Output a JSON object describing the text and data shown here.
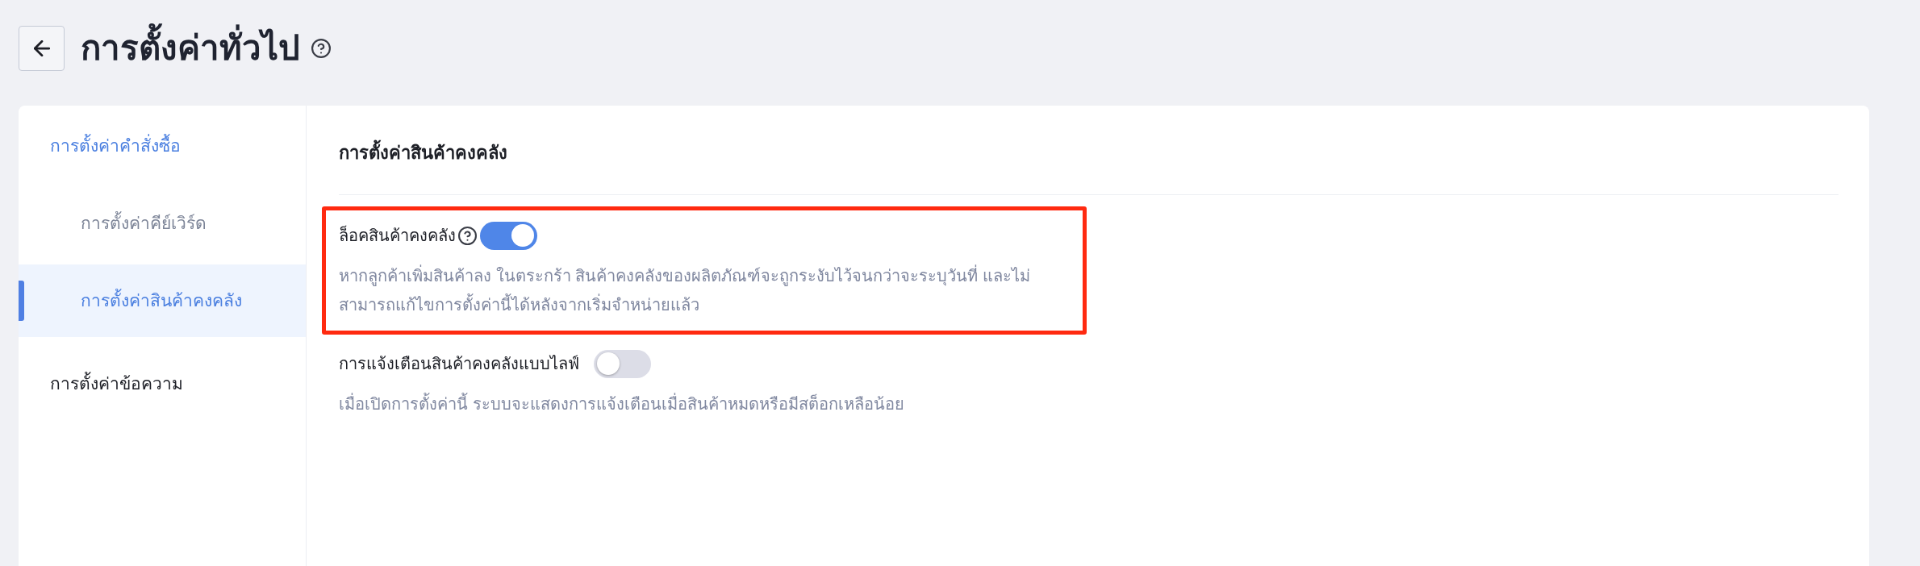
{
  "header": {
    "title": "การตั้งค่าทั่วไป"
  },
  "sidebar": {
    "items": [
      {
        "label": "การตั้งค่าคำสั่งซื้อ",
        "selected": false,
        "children": [
          {
            "label": "การตั้งค่าคีย์เวิร์ด",
            "selected": false
          },
          {
            "label": "การตั้งค่าสินค้าคงคลัง",
            "selected": true
          }
        ]
      },
      {
        "label": "การตั้งค่าข้อความ",
        "selected": false
      }
    ]
  },
  "section": {
    "title": "การตั้งค่าสินค้าคงคลัง",
    "settings": [
      {
        "label": "ล็อคสินค้าคงคลัง",
        "help_icon": true,
        "on": true,
        "highlighted": true,
        "description": "หากลูกค้าเพิ่มสินค้าลง ในตระกร้า สินค้าคงคลังของผลิตภัณฑ์จะถูกระงับไว้จนกว่าจะระบุวันที่ และไม่สามารถแก้ไขการตั้งค่านี้ได้หลังจากเริ่มจำหน่ายแล้ว"
      },
      {
        "label": "การแจ้งเตือนสินค้าคงคลังแบบไลฟ์",
        "help_icon": false,
        "on": false,
        "highlighted": false,
        "description": "เมื่อเปิดการตั้งค่านี้ ระบบจะแสดงการแจ้งเตือนเมื่อสินค้าหมดหรือมีสต็อกเหลือน้อย"
      }
    ]
  }
}
